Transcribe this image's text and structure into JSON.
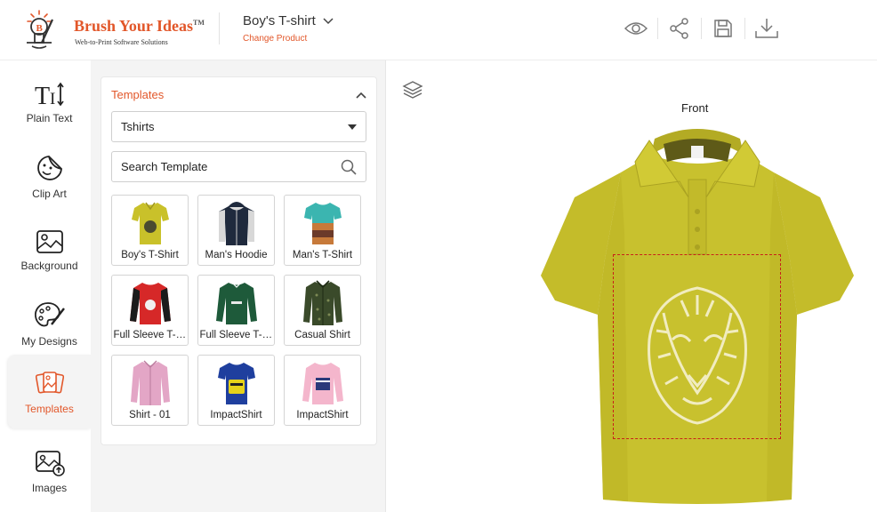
{
  "header": {
    "logo_title": "Brush Your Ideas",
    "logo_tm": "TM",
    "logo_subtitle": "Web-to-Print Software Solutions",
    "product_name": "Boy's T-shirt",
    "change_product": "Change Product",
    "actions": [
      "eye-icon",
      "share-icon",
      "save-icon",
      "download-icon"
    ]
  },
  "toolbar": {
    "items": [
      {
        "label": "Plain Text",
        "icon": "text-icon"
      },
      {
        "label": "Clip Art",
        "icon": "clipart-icon"
      },
      {
        "label": "Background",
        "icon": "background-icon"
      },
      {
        "label": "My Designs",
        "icon": "palette-icon"
      },
      {
        "label": "Templates",
        "icon": "templates-icon",
        "active": true
      },
      {
        "label": "Images",
        "icon": "image-upload-icon"
      }
    ]
  },
  "panel": {
    "title": "Templates",
    "category": "Tshirts",
    "search_placeholder": "Search Template",
    "templates": [
      {
        "label": "Boy's T-Shirt",
        "color": "#c9c12a"
      },
      {
        "label": "Man's Hoodie",
        "color": "#1f2a3d"
      },
      {
        "label": "Man's T-Shirt",
        "color": "#3bb5b0"
      },
      {
        "label": "Full Sleeve T-Shirt",
        "color": "#d62828"
      },
      {
        "label": "Full Sleeve T-Shirt",
        "color": "#1e5a3a"
      },
      {
        "label": "Casual Shirt",
        "color": "#3a4a2a"
      },
      {
        "label": "Shirt - 01",
        "color": "#e3a6c6"
      },
      {
        "label": "ImpactShirt",
        "color": "#1f3f9e"
      },
      {
        "label": "ImpactShirt",
        "color": "#f4b6cc"
      }
    ]
  },
  "canvas": {
    "side": "Front",
    "shirt_color": "#c8c12e",
    "print_area_color": "#c8201a"
  },
  "colors": {
    "accent": "#e2572a"
  }
}
